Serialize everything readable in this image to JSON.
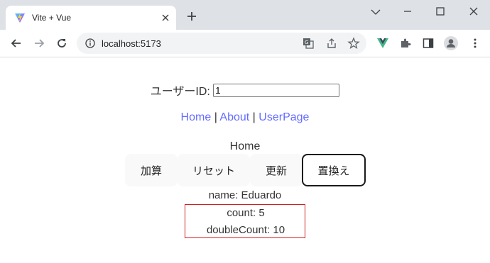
{
  "browser": {
    "tab_title": "Vite + Vue",
    "url": "localhost:5173",
    "icons": [
      "vite-favicon",
      "close-icon",
      "new-tab-icon",
      "minimize-icon",
      "maximize-icon",
      "window-close-icon",
      "back-icon",
      "forward-icon",
      "reload-icon",
      "site-info-icon",
      "translate-icon",
      "share-icon",
      "bookmark-star-icon",
      "vue-devtools-icon",
      "extensions-icon",
      "side-panel-icon",
      "profile-icon",
      "menu-icon"
    ]
  },
  "page": {
    "user_id_label": "ユーザーID:",
    "user_id_value": "1",
    "nav": {
      "home": "Home",
      "sep1": "|",
      "about": "About",
      "sep2": "|",
      "userpage": "UserPage"
    },
    "view_title": "Home",
    "buttons": {
      "add": "加算",
      "reset": "リセット",
      "update": "更新",
      "replace": "置換え"
    },
    "name_line": "name: Eduardo",
    "count_line": "count: 5",
    "double_count_line": "doubleCount: 10"
  },
  "colors": {
    "link": "#646cff",
    "count_box_border": "#d02020",
    "active_button_border": "#1a1a1a"
  }
}
